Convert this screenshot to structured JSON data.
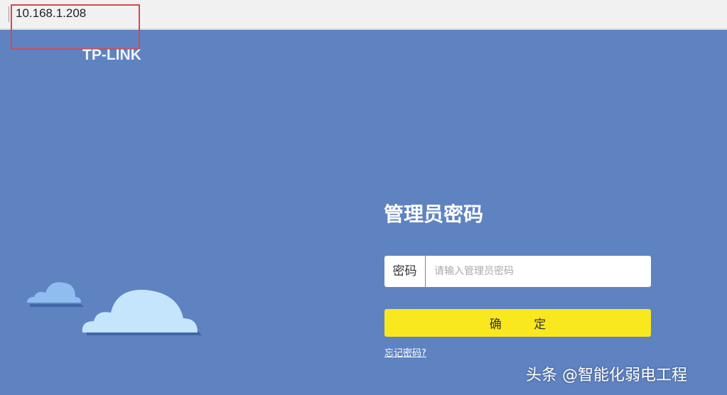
{
  "browser": {
    "url": "10.168.1.208"
  },
  "brand": {
    "logo": "TP-LINK"
  },
  "login": {
    "title": "管理员密码",
    "password_label": "密码",
    "password_placeholder": "请输入管理员密码",
    "password_value": "",
    "confirm_label": "确 定",
    "forgot_link": "忘记密码?"
  },
  "watermark": "头条 @智能化弱电工程",
  "colors": {
    "background": "#5f83c1",
    "button": "#f9e81e",
    "highlight": "#d9484a"
  }
}
